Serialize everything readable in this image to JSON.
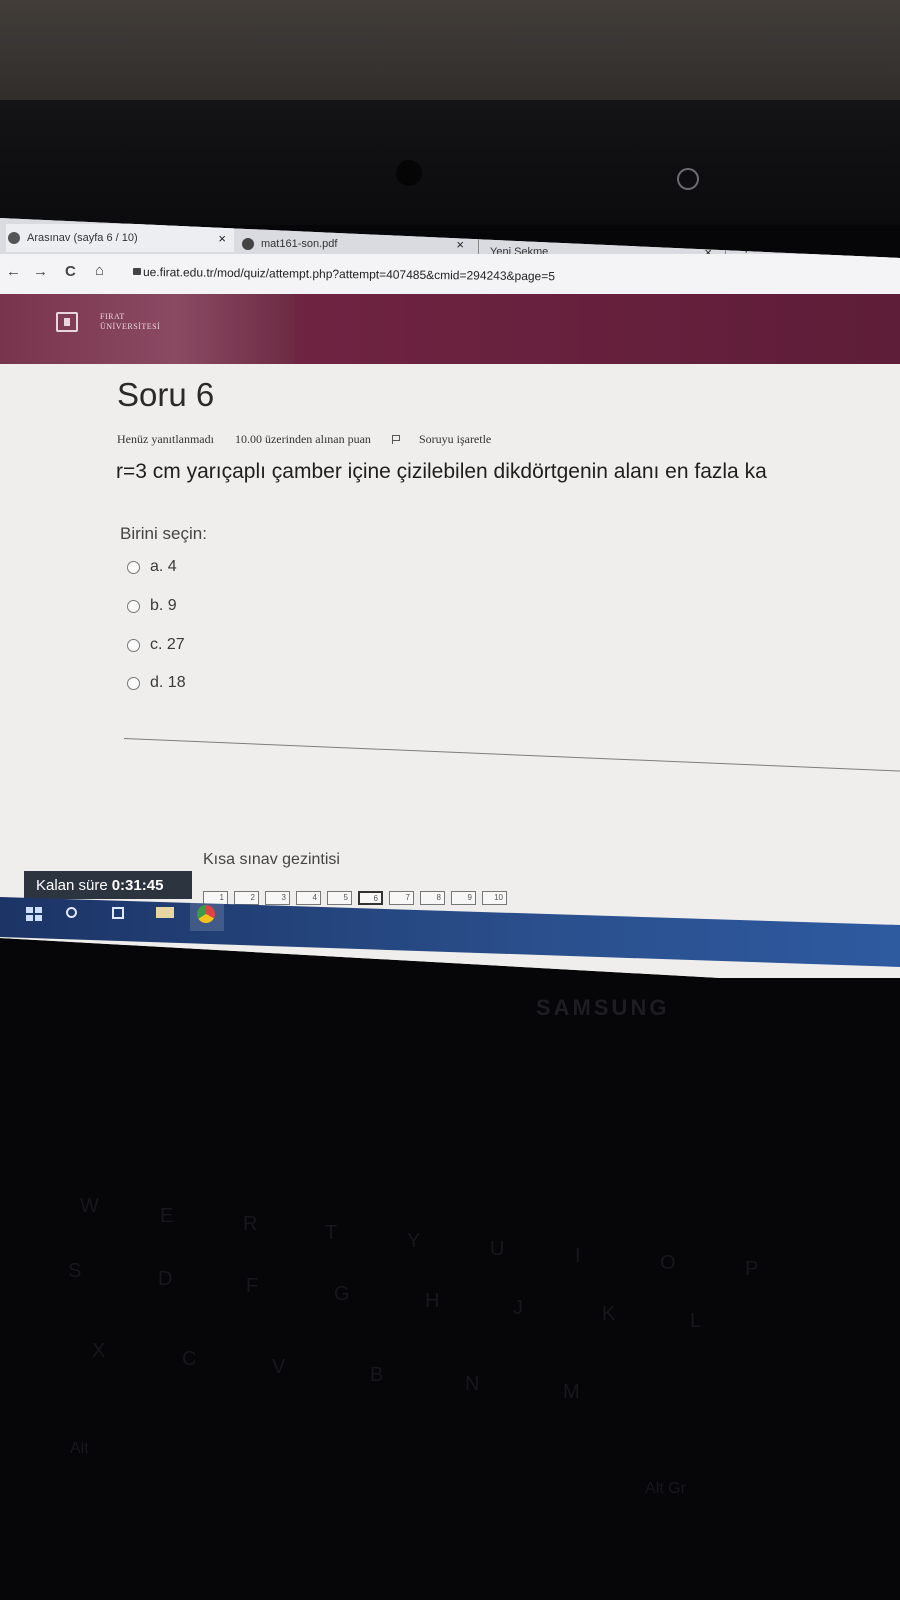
{
  "browser": {
    "tabs": [
      {
        "title": "Arasınav (sayfa 6 / 10)",
        "close": "×"
      },
      {
        "title": "mat161-son.pdf",
        "close": "×"
      },
      {
        "title": "Yeni Sekme",
        "close": "×"
      }
    ],
    "new_tab": "+",
    "nav": {
      "back": "←",
      "forward": "→",
      "reload": "C",
      "home": "⌂"
    },
    "url": "ue.firat.edu.tr/mod/quiz/attempt.php?attempt=407485&cmid=294243&page=5"
  },
  "site": {
    "logo_line1": "FIRAT",
    "logo_line2": "ÜNİVERSİTESİ",
    "brand_color": "#6f2442"
  },
  "question": {
    "title": "Soru 6",
    "status": "Henüz yanıtlanmadı",
    "points": "10.00 üzerinden alınan puan",
    "flag_label": "Soruyu işaretle",
    "text": "r=3 cm yarıçaplı çamber içine çizilebilen dikdörtgenin alanı en fazla ka",
    "prompt": "Birini seçin:",
    "options": [
      {
        "label": "a. 4"
      },
      {
        "label": "b. 9"
      },
      {
        "label": "c. 27"
      },
      {
        "label": "d. 18"
      }
    ]
  },
  "quiz_nav": {
    "title": "Kısa sınav gezintisi",
    "timer_label": "Kalan süre",
    "timer_value": "0:31:45",
    "pages": [
      "1",
      "2",
      "3",
      "4",
      "5",
      "6",
      "7",
      "8",
      "9",
      "10"
    ],
    "current_page": "6"
  },
  "taskbar": {
    "icons": [
      "windows-icon",
      "search-icon",
      "task-view-icon",
      "file-explorer-icon",
      "chrome-icon"
    ]
  },
  "laptop": {
    "brand": "SAMSUNG",
    "keys": [
      "W",
      "E",
      "R",
      "T",
      "Y",
      "U",
      "I",
      "O",
      "P",
      "S",
      "D",
      "F",
      "G",
      "H",
      "J",
      "K",
      "L",
      "X",
      "C",
      "V",
      "B",
      "N",
      "M",
      "Alt",
      "Alt Gr"
    ]
  }
}
